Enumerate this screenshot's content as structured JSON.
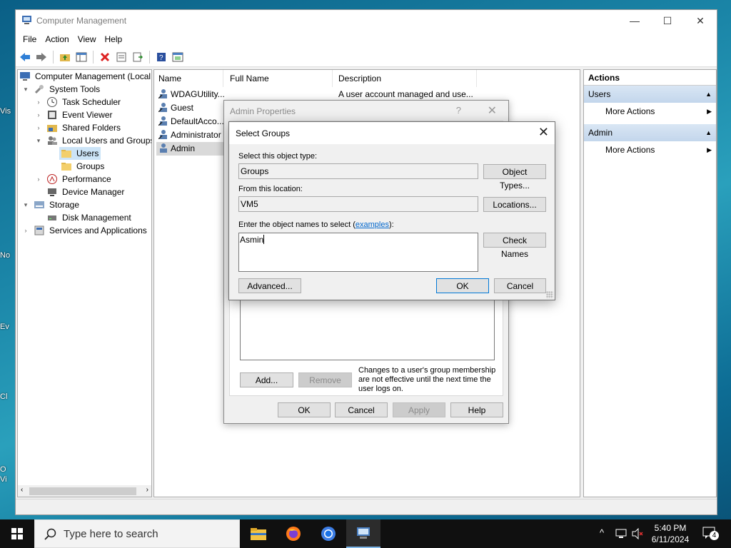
{
  "desktop": {
    "icons": [
      "Vis",
      "No",
      "Ev",
      "Cl",
      "O",
      "Vi"
    ]
  },
  "window": {
    "title": "Computer Management",
    "controls": {
      "minimize": "—",
      "maximize": "☐",
      "close": "✕"
    },
    "menu": [
      "File",
      "Action",
      "View",
      "Help"
    ]
  },
  "tree": {
    "root": "Computer Management (Local",
    "system_tools": "System Tools",
    "task_scheduler": "Task Scheduler",
    "event_viewer": "Event Viewer",
    "shared_folders": "Shared Folders",
    "local_users_groups": "Local Users and Groups",
    "users": "Users",
    "groups": "Groups",
    "performance": "Performance",
    "device_manager": "Device Manager",
    "storage": "Storage",
    "disk_management": "Disk Management",
    "services_apps": "Services and Applications"
  },
  "list": {
    "columns": [
      "Name",
      "Full Name",
      "Description"
    ],
    "rows": [
      {
        "name": "WDAGUtility...",
        "description": "A user account managed and use..."
      },
      {
        "name": "Guest",
        "description": ""
      },
      {
        "name": "DefaultAcco...",
        "description": ""
      },
      {
        "name": "Administrator",
        "description": ""
      },
      {
        "name": "Admin",
        "description": ""
      }
    ]
  },
  "actions": {
    "header": "Actions",
    "sections": [
      {
        "title": "Users",
        "item": "More Actions"
      },
      {
        "title": "Admin",
        "item": "More Actions"
      }
    ]
  },
  "props_dialog": {
    "title": "Admin Properties",
    "help_glyph": "?",
    "close_glyph": "✕",
    "add": "Add...",
    "remove": "Remove",
    "note": "Changes to a user's group membership are not effective until the next time the user logs on.",
    "ok": "OK",
    "cancel": "Cancel",
    "apply": "Apply",
    "help": "Help"
  },
  "select_dialog": {
    "title": "Select Groups",
    "close_glyph": "✕",
    "object_type_label": "Select this object type:",
    "object_type_value": "Groups",
    "object_types_btn": "Object Types...",
    "location_label": "From this location:",
    "location_value": "VM5",
    "locations_btn": "Locations...",
    "names_label_pre": "Enter the object names to select (",
    "names_label_link": "examples",
    "names_label_post": "):",
    "names_value": "Asmin",
    "check_names_btn": "Check Names",
    "advanced_btn": "Advanced...",
    "ok_btn": "OK",
    "cancel_btn": "Cancel"
  },
  "taskbar": {
    "search_placeholder": "Type here to search",
    "time": "5:40 PM",
    "date": "6/11/2024",
    "notification_count": "4"
  }
}
